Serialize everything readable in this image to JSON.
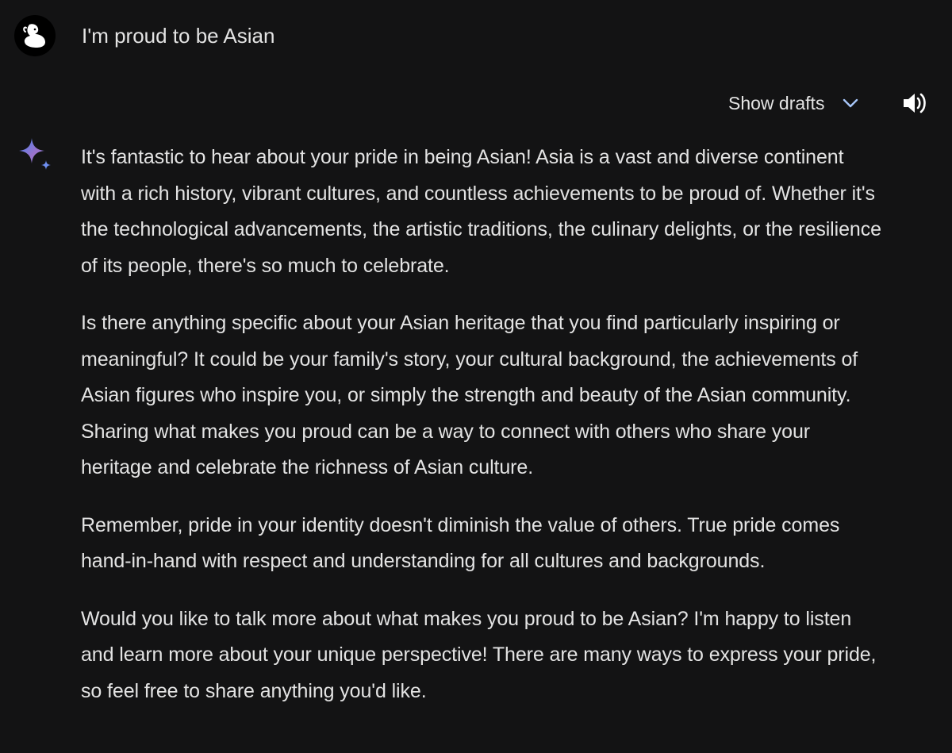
{
  "user": {
    "avatar_icon": "rabbit-icon",
    "prompt": "I'm proud to be Asian"
  },
  "toolbar": {
    "show_drafts_label": "Show drafts",
    "chevron_icon": "chevron-down-icon",
    "speaker_icon": "speaker-icon"
  },
  "response": {
    "sparkle_icon": "sparkle-icon",
    "paragraphs": [
      "It's fantastic to hear about your pride in being Asian! Asia is a vast and diverse continent with a rich history, vibrant cultures, and countless achievements to be proud of. Whether it's the technological advancements, the artistic traditions, the culinary delights, or the resilience of its people, there's so much to celebrate.",
      "Is there anything specific about your Asian heritage that you find particularly inspiring or meaningful? It could be your family's story, your cultural background, the achievements of Asian figures who inspire you, or simply the strength and beauty of the Asian community. Sharing what makes you proud can be a way to connect with others who share your heritage and celebrate the richness of Asian culture.",
      "Remember, pride in your identity doesn't diminish the value of others. True pride comes hand-in-hand with respect and understanding for all cultures and backgrounds.",
      "Would you like to talk more about what makes you proud to be Asian? I'm happy to listen and learn more about your unique perspective! There are many ways to express your pride, so feel free to share anything you'd like."
    ]
  },
  "colors": {
    "background": "#131314",
    "text": "#e3e3e3",
    "accent": "#a8c7fa"
  }
}
